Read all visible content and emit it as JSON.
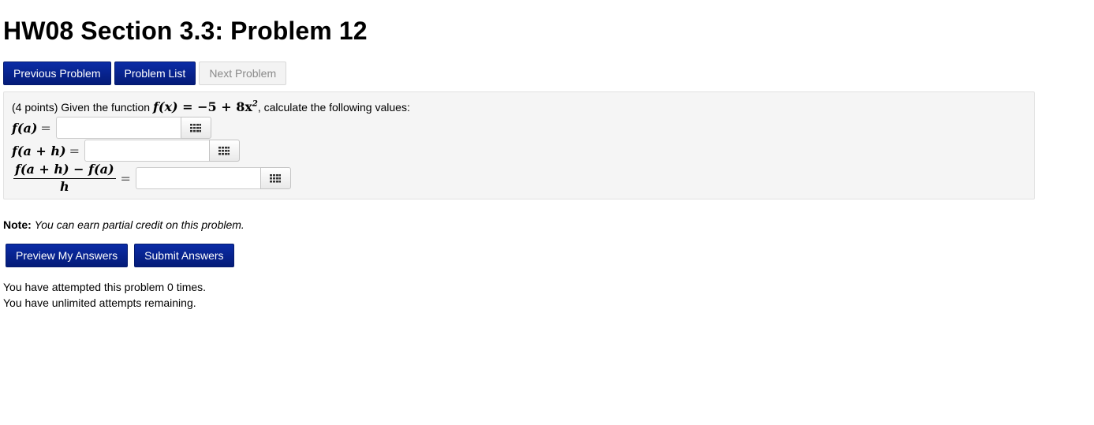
{
  "page": {
    "title": "HW08 Section 3.3: Problem 12"
  },
  "nav": {
    "previous_label": "Previous Problem",
    "list_label": "Problem List",
    "next_label": "Next Problem"
  },
  "problem": {
    "intro": "(4 points) Given the function",
    "function_lhs": "f(x)",
    "function_eq": " = −5 + 8x",
    "function_exp": "2",
    "outro": ", calculate the following values:",
    "answers": [
      {
        "label": "f(a)",
        "value": "",
        "placeholder": ""
      },
      {
        "label": "f(a + h)",
        "value": "",
        "placeholder": ""
      },
      {
        "numerator": "f(a + h) − f(a)",
        "denominator": "h",
        "value": "",
        "placeholder": ""
      }
    ],
    "equals": "="
  },
  "note": {
    "label": "Note:",
    "text": "You can earn partial credit on this problem."
  },
  "actions": {
    "preview_label": "Preview My Answers",
    "submit_label": "Submit Answers"
  },
  "status": {
    "attempts_line": "You have attempted this problem 0 times.",
    "remaining_line": "You have unlimited attempts remaining."
  },
  "icons": {
    "equation_editor": "grid-icon"
  },
  "colors": {
    "primary_button": "#07238f",
    "disabled_button": "#f3f3f3",
    "problem_background": "#f5f5f5"
  }
}
